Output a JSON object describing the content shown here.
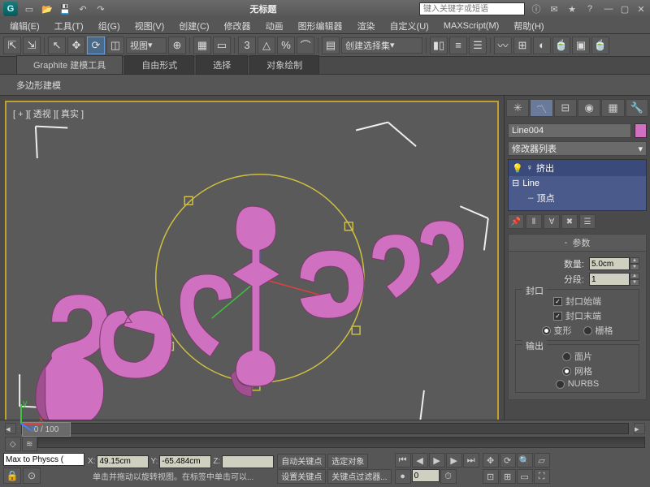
{
  "title": "无标题",
  "search_placeholder": "键入关键字或短语",
  "menu": [
    "编辑(E)",
    "工具(T)",
    "组(G)",
    "视图(V)",
    "创建(C)",
    "修改器",
    "动画",
    "图形编辑器",
    "渲染",
    "自定义(U)",
    "MAXScript(M)",
    "帮助(H)"
  ],
  "toolbar_view_combo": "视图",
  "toolbar_select_set": "创建选择集",
  "ribbon_tabs": [
    "Graphite 建模工具",
    "自由形式",
    "选择",
    "对象绘制"
  ],
  "ribbon_section": "多边形建模",
  "viewport_label": "[ + ][ 透视 ][ 真实 ]",
  "right": {
    "object_name": "Line004",
    "modlist_label": "修改器列表",
    "stack": {
      "extrude": "挤出",
      "line": "Line",
      "vertex": "顶点"
    },
    "rollout_params": "参数",
    "amount_label": "数量:",
    "amount_value": "5.0cm",
    "segments_label": "分段:",
    "segments_value": "1",
    "group_cap": "封口",
    "cap_start": "封口始端",
    "cap_end": "封口末端",
    "morph": "变形",
    "grid": "栅格",
    "group_output": "输出",
    "out_patch": "面片",
    "out_mesh": "网格",
    "out_nurbs": "NURBS"
  },
  "timeline": {
    "frame": "0 / 100"
  },
  "status": {
    "script": "Max to Physcs (",
    "x": "49.15cm",
    "y": "-65.484cm",
    "z": "",
    "prompt1": "单击并拖动以旋转视图。在标签中单击可以...",
    "prompt2": "设置关键点... 关键点过滤器...",
    "auto_key": "自动关键点",
    "sel_lock": "选定对象",
    "set_key": "设置关键点",
    "key_filter": "关键点过滤器..."
  }
}
